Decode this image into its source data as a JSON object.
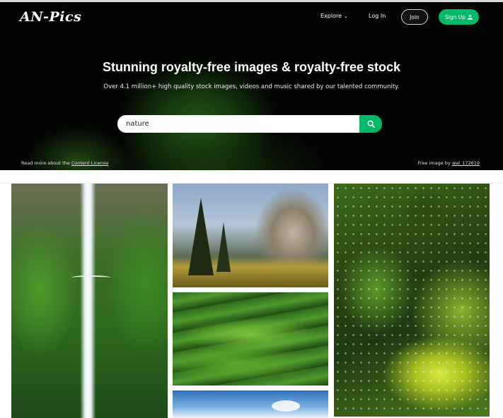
{
  "header": {
    "logo_text": "AN-Pics",
    "nav": {
      "explore_label": "Explore",
      "login_label": "Log In",
      "join_label": "Join",
      "signup_label": "Sign Up"
    }
  },
  "hero": {
    "headline": "Stunning royalty-free images & royalty-free stock",
    "subline": "Over 4.1 million+ high quality stock images, videos and music shared by our talented community.",
    "search": {
      "value": "nature",
      "placeholder": ""
    },
    "footer_left": {
      "prefix": "Read more about the ",
      "link": "Content License"
    },
    "footer_right": {
      "prefix": "Free image by ",
      "link": "wal_172619"
    }
  },
  "gallery": {
    "images": [
      {
        "subject": "waterfall"
      },
      {
        "subject": "mountain-forest"
      },
      {
        "subject": "green-hills"
      },
      {
        "subject": "leaves-bokeh"
      },
      {
        "subject": "sky"
      }
    ]
  },
  "colors": {
    "accent": "#04b869",
    "hero_background": "#050705"
  },
  "icons": {
    "search": "search-icon",
    "user": "user-icon",
    "chevron": "chevron-down-icon"
  }
}
